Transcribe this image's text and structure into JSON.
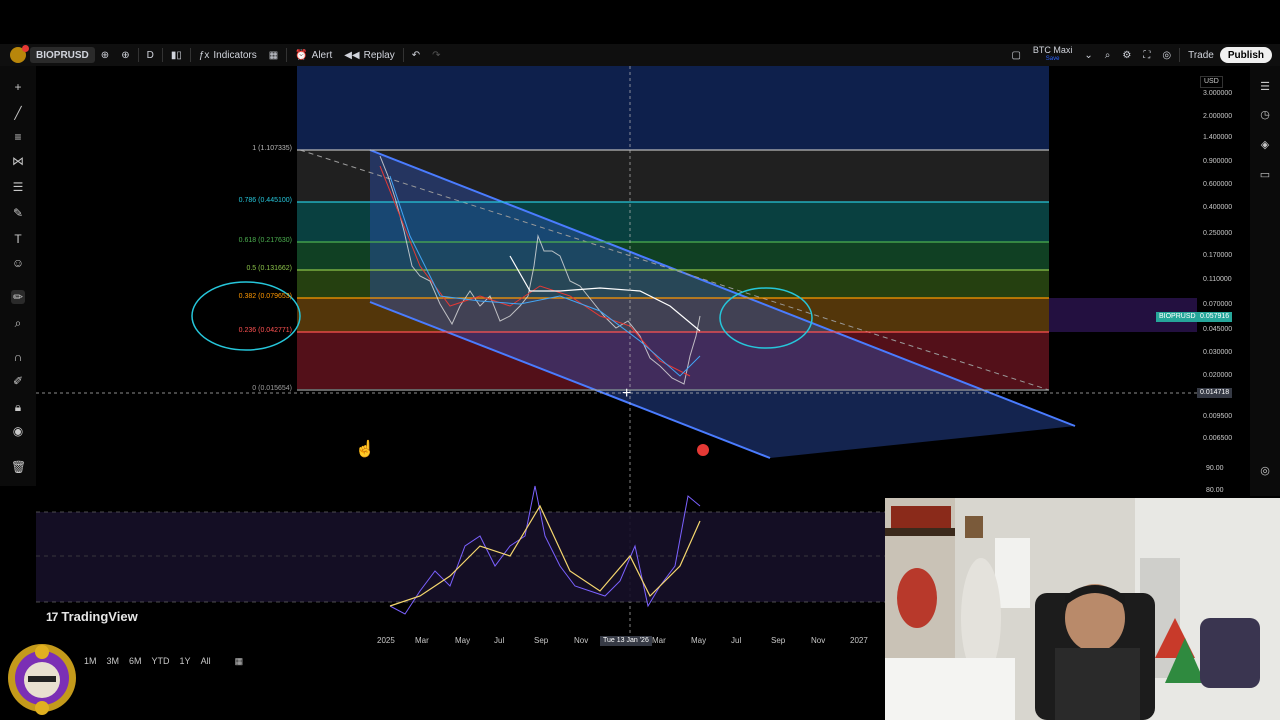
{
  "toolbar": {
    "symbol": "BIOPRUSD",
    "interval": "D",
    "indicators": "Indicators",
    "alert": "Alert",
    "replay": "Replay",
    "layout_name": "BTC Maxi",
    "layout_sub": "Save",
    "trade": "Trade",
    "publish": "Publish",
    "currency": "USD"
  },
  "fib_levels": [
    {
      "label": "1 (1.107335)",
      "color": "#b8b8b8"
    },
    {
      "label": "0.786 (0.445100)",
      "color": "#26c6da"
    },
    {
      "label": "0.618 (0.217630)",
      "color": "#4caf50"
    },
    {
      "label": "0.5 (0.131662)",
      "color": "#8bc34a"
    },
    {
      "label": "0.382 (0.079653)",
      "color": "#ff9800"
    },
    {
      "label": "0.236 (0.042771)",
      "color": "#ff5252"
    },
    {
      "label": "0 (0.015654)",
      "color": "#9e9e9e"
    }
  ],
  "price_axis": [
    "3.000000",
    "2.000000",
    "1.400000",
    "0.900000",
    "0.600000",
    "0.400000",
    "0.250000",
    "0.170000",
    "0.110000",
    "0.070000",
    "0.045000",
    "0.030000",
    "0.020000",
    "0.009500",
    "0.006500"
  ],
  "current_price": {
    "symbol": "BIOPRUSD",
    "value": "0.057916",
    "color": "#26a69a"
  },
  "crosshair_price": "0.014718",
  "time_axis": [
    "2025",
    "Mar",
    "May",
    "Jul",
    "Sep",
    "Nov",
    "Jan",
    "Mar",
    "May",
    "Jul",
    "Sep",
    "Nov",
    "2027"
  ],
  "crosshair_date": "Tue 13 Jan '26",
  "rsi_axis": [
    "90.00",
    "80.00"
  ],
  "watermark": "TradingView",
  "ranges": [
    "1M",
    "3M",
    "6M",
    "YTD",
    "1Y",
    "All"
  ]
}
